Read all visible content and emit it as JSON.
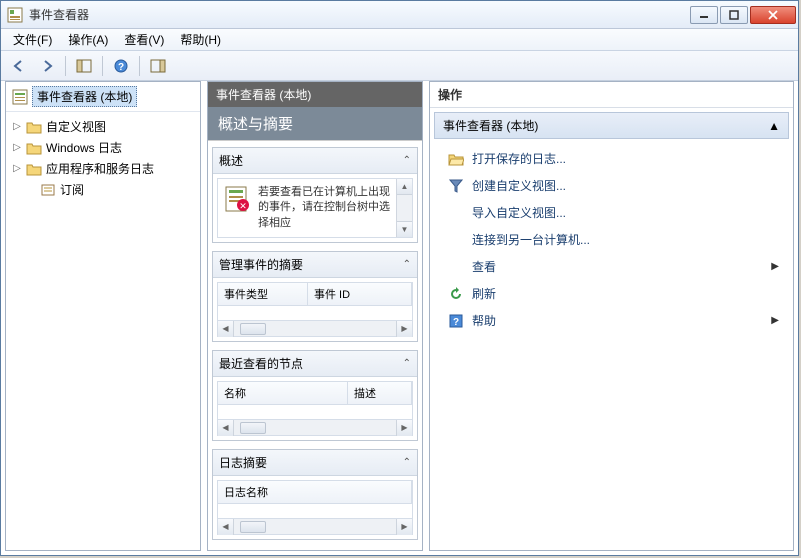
{
  "window": {
    "title": "事件查看器"
  },
  "menu": {
    "file": "文件(F)",
    "action": "操作(A)",
    "view": "查看(V)",
    "help": "帮助(H)"
  },
  "tree": {
    "root": "事件查看器 (本地)",
    "nodes": {
      "custom_views": "自定义视图",
      "windows_logs": "Windows 日志",
      "app_service_logs": "应用程序和服务日志",
      "subscriptions": "订阅"
    }
  },
  "center": {
    "header": "事件查看器 (本地)",
    "title": "概述与摘要",
    "sections": {
      "overview": {
        "label": "概述",
        "text": "若要查看已在计算机上出现的事件，请在控制台树中选择相应"
      },
      "admin_summary": {
        "label": "管理事件的摘要",
        "col1": "事件类型",
        "col2": "事件 ID"
      },
      "recent_nodes": {
        "label": "最近查看的节点",
        "col1": "名称",
        "col2": "描述"
      },
      "log_summary": {
        "label": "日志摘要",
        "col1": "日志名称"
      }
    }
  },
  "actions": {
    "header": "操作",
    "group": "事件查看器 (本地)",
    "items": {
      "open_saved": "打开保存的日志...",
      "create_custom": "创建自定义视图...",
      "import_custom": "导入自定义视图...",
      "connect": "连接到另一台计算机...",
      "view": "查看",
      "refresh": "刷新",
      "help": "帮助"
    }
  }
}
